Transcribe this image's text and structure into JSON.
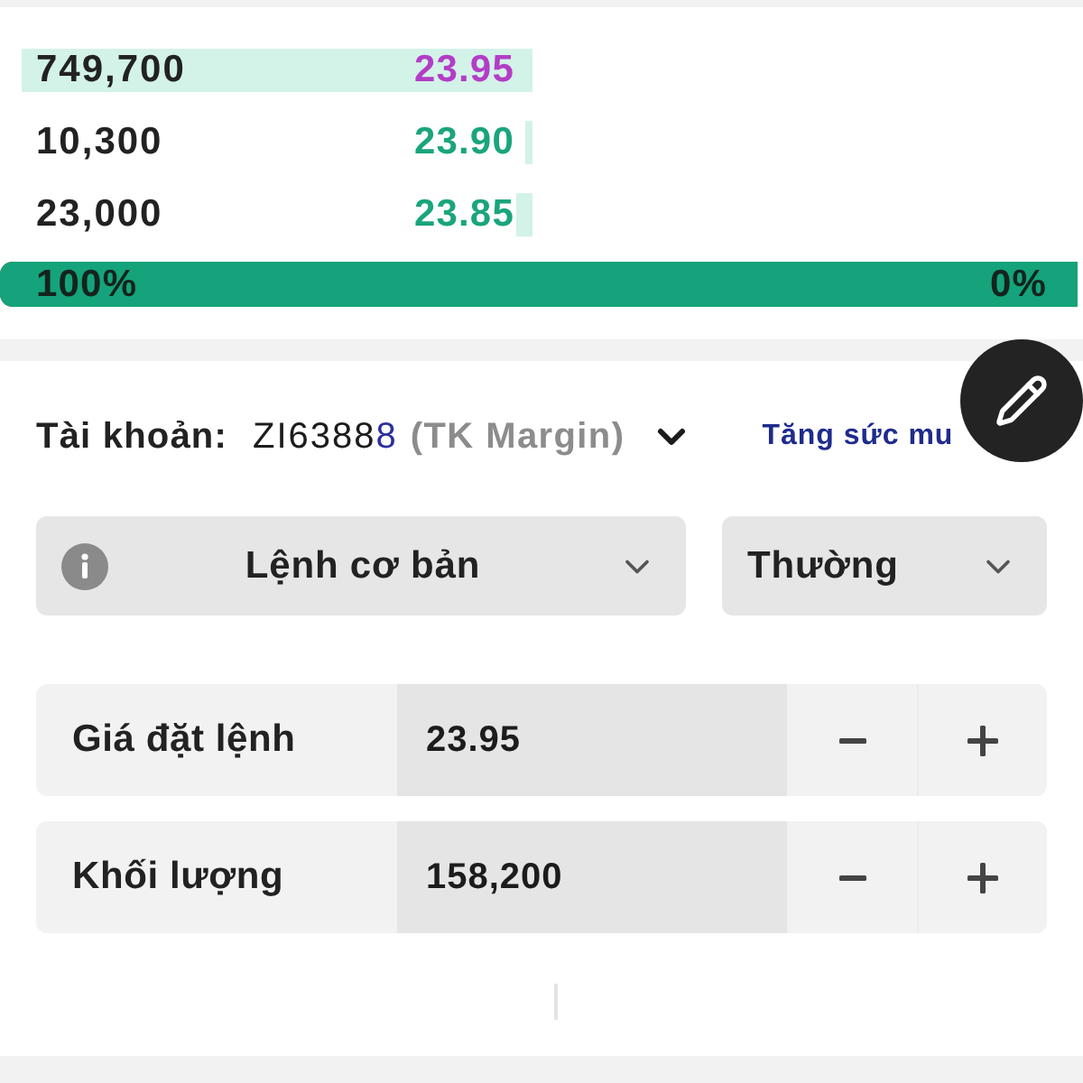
{
  "order_book": {
    "rows": [
      {
        "volume": "749,700",
        "price": "23.95",
        "color": "#b33dc6",
        "level": 1
      },
      {
        "volume": "10,300",
        "price": "23.90",
        "color": "#1aa57c",
        "level": 0.014
      },
      {
        "volume": "23,000",
        "price": "23.85",
        "color": "#1aa57c",
        "level": 0.031
      }
    ],
    "ratio_bar": {
      "level": 1,
      "left_label": "100%",
      "right_label": "0%"
    }
  },
  "account": {
    "label": "Tài khoản:",
    "number_parts": [
      {
        "text": "ZI6388",
        "highlight": false
      },
      {
        "text": "8",
        "highlight": true
      }
    ],
    "type": "(TK Margin)",
    "link": "Tăng sức mu"
  },
  "order_type": {
    "main": "Lệnh cơ bản",
    "sub": "Thường"
  },
  "inputs": [
    {
      "label": "Giá đặt lệnh",
      "value": "23.95"
    },
    {
      "label": "Khối lượng",
      "value": "158,200"
    }
  ]
}
